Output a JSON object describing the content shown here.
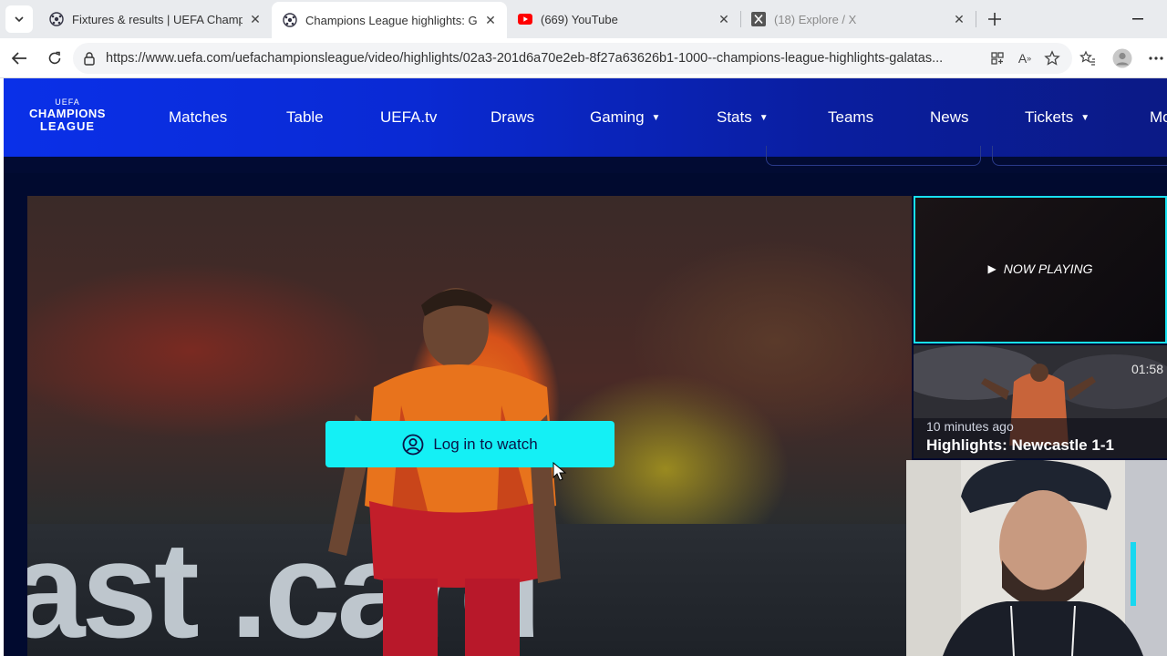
{
  "browser": {
    "tabs": [
      {
        "title": "Fixtures & results | UEFA Champions",
        "favicon": "uefa-ball-icon",
        "active": false
      },
      {
        "title": "Champions League highlights: Galatasaray",
        "favicon": "uefa-ball-icon",
        "active": true
      },
      {
        "title": "(669) YouTube",
        "favicon": "youtube-icon",
        "active": false
      },
      {
        "title": "(18) Explore / X",
        "favicon": "x-icon",
        "active": false
      }
    ],
    "url": "https://www.uefa.com/uefachampionsleague/video/highlights/02a3-201d6a70e2eb-8f27a63626b1-1000--champions-league-highlights-galatas..."
  },
  "site": {
    "logo": {
      "line1": "CHAMPIONS",
      "line2": "LEAGUE",
      "top": "UEFA"
    },
    "nav": [
      {
        "label": "Matches",
        "dropdown": false
      },
      {
        "label": "Table",
        "dropdown": false
      },
      {
        "label": "UEFA.tv",
        "dropdown": false
      },
      {
        "label": "Draws",
        "dropdown": false
      },
      {
        "label": "Gaming",
        "dropdown": true
      },
      {
        "label": "Stats",
        "dropdown": true
      },
      {
        "label": "Teams",
        "dropdown": false
      },
      {
        "label": "News",
        "dropdown": false
      },
      {
        "label": "Tickets",
        "dropdown": true
      },
      {
        "label": "Mo",
        "dropdown": false
      }
    ]
  },
  "player": {
    "login_label": "Log in to watch",
    "board_text": "ast .card"
  },
  "playlist": {
    "now_playing": "NOW PLAYING",
    "next": {
      "duration": "01:58",
      "time_ago": "10 minutes ago",
      "title": "Highlights: Newcastle 1-1"
    }
  },
  "colors": {
    "accent": "#14f0f5",
    "nav_blue": "#0a30e8",
    "page_bg": "#010a2f"
  }
}
